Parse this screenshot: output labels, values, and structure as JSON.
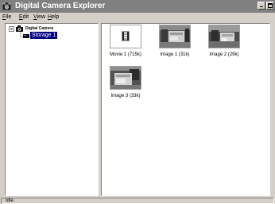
{
  "window": {
    "title": "Digital Camera Explorer"
  },
  "menu": {
    "items": [
      {
        "label": "ile",
        "mnemonic": "F"
      },
      {
        "label": "dit",
        "mnemonic": "E"
      },
      {
        "label": "iew",
        "mnemonic": "V"
      },
      {
        "label": "elp",
        "mnemonic": "H"
      }
    ]
  },
  "tree": {
    "root_label": "Digital Camera",
    "child_label": "Storage 1"
  },
  "files": [
    {
      "label": "Movie 1 (715k)",
      "kind": "movie"
    },
    {
      "label": "Image 1 (31k)",
      "kind": "image"
    },
    {
      "label": "Image 2 (29k)",
      "kind": "image"
    },
    {
      "label": "Image 3 (33k)",
      "kind": "image"
    }
  ],
  "status": {
    "text": "Idle."
  },
  "colors": {
    "titlebar_inactive": "#808080",
    "selection": "#000080",
    "face": "#d4d0c8"
  },
  "icons": {
    "app": "camera-app-icon",
    "minimize": "minimize-icon",
    "maximize": "maximize-icon",
    "tree_root": "camera-icon",
    "tree_child": "storage-card-icon",
    "movie": "film-icon"
  }
}
